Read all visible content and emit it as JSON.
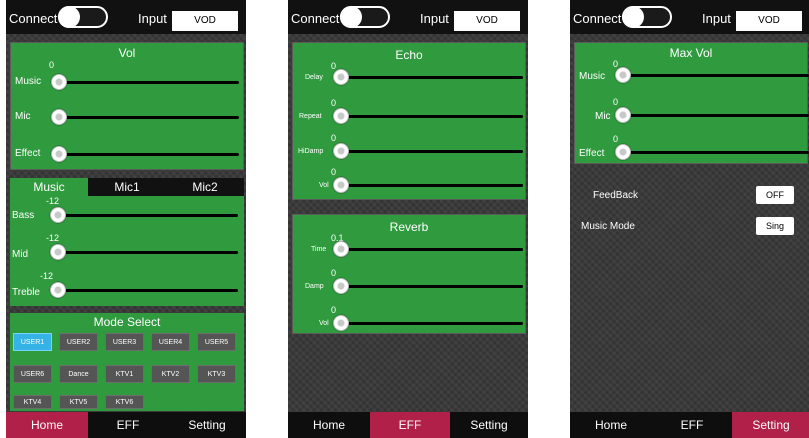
{
  "header": {
    "connect_label": "Connect",
    "input_label": "Input",
    "input_value": "VOD"
  },
  "home": {
    "vol_title": "Vol",
    "vol": [
      {
        "label": "Music",
        "value": "0"
      },
      {
        "label": "Mic",
        "value": ""
      },
      {
        "label": "Effect",
        "value": ""
      }
    ],
    "tabs": [
      "Music",
      "Mic1",
      "Mic2"
    ],
    "eq": [
      {
        "label": "Bass",
        "value": "-12"
      },
      {
        "label": "Mid",
        "value": "-12"
      },
      {
        "label": "Treble",
        "value": "-12"
      }
    ],
    "mode_title": "Mode Select",
    "modes": [
      "USER1",
      "USER2",
      "USER3",
      "USER4",
      "USER5",
      "USER6",
      "Dance",
      "KTV1",
      "KTV2",
      "KTV3",
      "KTV4",
      "KTV5",
      "KTV6"
    ],
    "selected_mode": "USER1"
  },
  "eff": {
    "echo_title": "Echo",
    "echo": [
      {
        "label": "Delay",
        "value": "0"
      },
      {
        "label": "Repeat",
        "value": "0"
      },
      {
        "label": "HiDamp",
        "value": "0"
      },
      {
        "label": "Vol",
        "value": "0"
      }
    ],
    "reverb_title": "Reverb",
    "reverb": [
      {
        "label": "Time",
        "value": "0.1"
      },
      {
        "label": "Damp",
        "value": "0"
      },
      {
        "label": "Vol",
        "value": "0"
      }
    ]
  },
  "setting": {
    "maxvol_title": "Max Vol",
    "maxvol": [
      {
        "label": "Music",
        "value": "0"
      },
      {
        "label": "Mic",
        "value": "0"
      },
      {
        "label": "Effect",
        "value": "0"
      }
    ],
    "feedback_label": "FeedBack",
    "feedback_value": "OFF",
    "music_mode_label": "Music Mode",
    "music_mode_value": "Sing"
  },
  "nav": [
    "Home",
    "EFF",
    "Setting"
  ],
  "active_nav": [
    "Home",
    "EFF",
    "Setting"
  ]
}
